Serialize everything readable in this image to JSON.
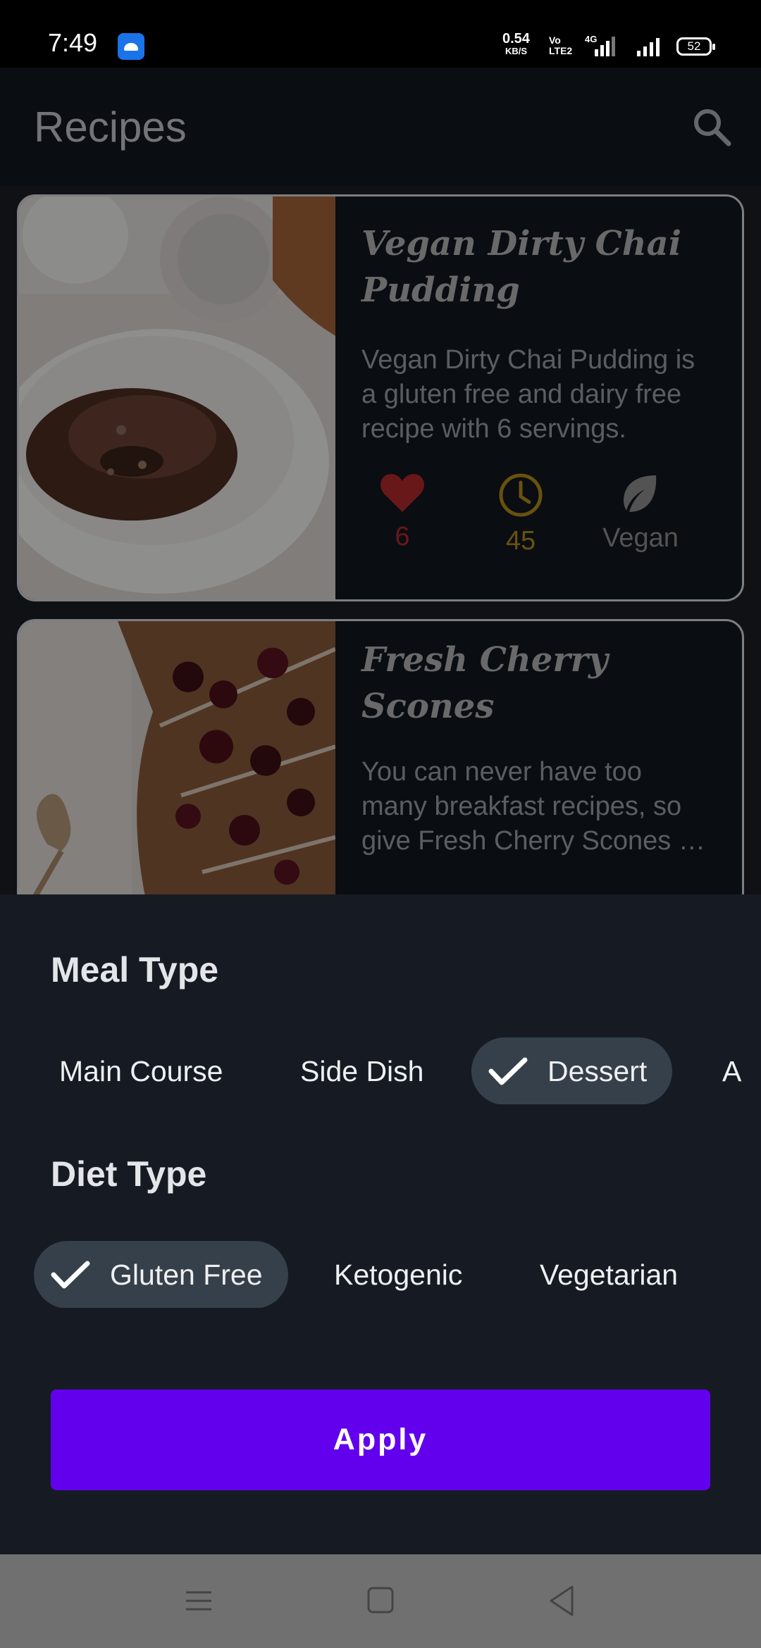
{
  "status_bar": {
    "time": "7:49",
    "speed_value": "0.54",
    "speed_unit": "KB/S",
    "volte_top": "Vo",
    "volte_bottom": "LTE2",
    "network": "4G",
    "battery": "52"
  },
  "app_bar": {
    "title": "Recipes",
    "search_icon": "search-icon"
  },
  "recipes": [
    {
      "title": "Vegan Dirty Chai Pudding",
      "description": "Vegan Dirty Chai Pudding is a gluten free and dairy free recipe with 6 servings.",
      "likes": "6",
      "minutes": "45",
      "vegan_label": "Vegan",
      "image": "chocolate-pudding-image"
    },
    {
      "title": "Fresh Cherry Scones",
      "description": "You can never have too many breakfast recipes, so give Fresh Cherry Scones a try.",
      "likes": "",
      "minutes": "",
      "vegan_label": "",
      "image": "cherry-scones-image"
    }
  ],
  "filter_sheet": {
    "meal_type_title": "Meal Type",
    "meal_types": [
      "Main Course",
      "Side Dish",
      "Dessert",
      "A"
    ],
    "meal_type_selected": "Dessert",
    "diet_type_title": "Diet Type",
    "diet_types": [
      "Gluten Free",
      "Ketogenic",
      "Vegetarian"
    ],
    "diet_type_selected": "Gluten Free",
    "apply_label": "Apply"
  },
  "colors": {
    "accent": "#6200ee",
    "like": "#b32a2a",
    "time": "#b38e16",
    "vegan": "#8f8f8f"
  }
}
